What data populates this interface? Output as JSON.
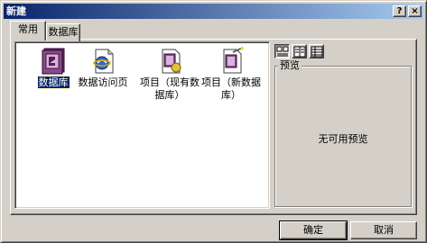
{
  "window": {
    "title": "新建",
    "help_glyph": "?",
    "close_glyph": "×"
  },
  "tabs": [
    {
      "label": "常用",
      "active": true
    },
    {
      "label": "数据库",
      "active": false
    }
  ],
  "items": [
    {
      "label": "数据库",
      "icon": "database-icon",
      "selected": true
    },
    {
      "label": "数据访问页",
      "icon": "data-access-page-icon",
      "selected": false
    },
    {
      "label_line1": "项目（现有数",
      "label_line2": "据库）",
      "icon": "project-existing-db-icon",
      "selected": false
    },
    {
      "label_line1": "项目（新数据",
      "label_line2": "库）",
      "icon": "project-new-db-icon",
      "selected": false
    }
  ],
  "view_buttons": [
    {
      "name": "large-icons-view",
      "pressed": true
    },
    {
      "name": "list-view",
      "pressed": false
    },
    {
      "name": "details-view",
      "pressed": false
    }
  ],
  "preview": {
    "legend": "预览",
    "empty_text": "无可用预览"
  },
  "buttons": {
    "ok": "确定",
    "cancel": "取消"
  },
  "colors": {
    "title_bar_start": "#0a246a",
    "title_bar_end": "#a6caf0",
    "face": "#d4d0c8",
    "selection": "#0a246a"
  }
}
